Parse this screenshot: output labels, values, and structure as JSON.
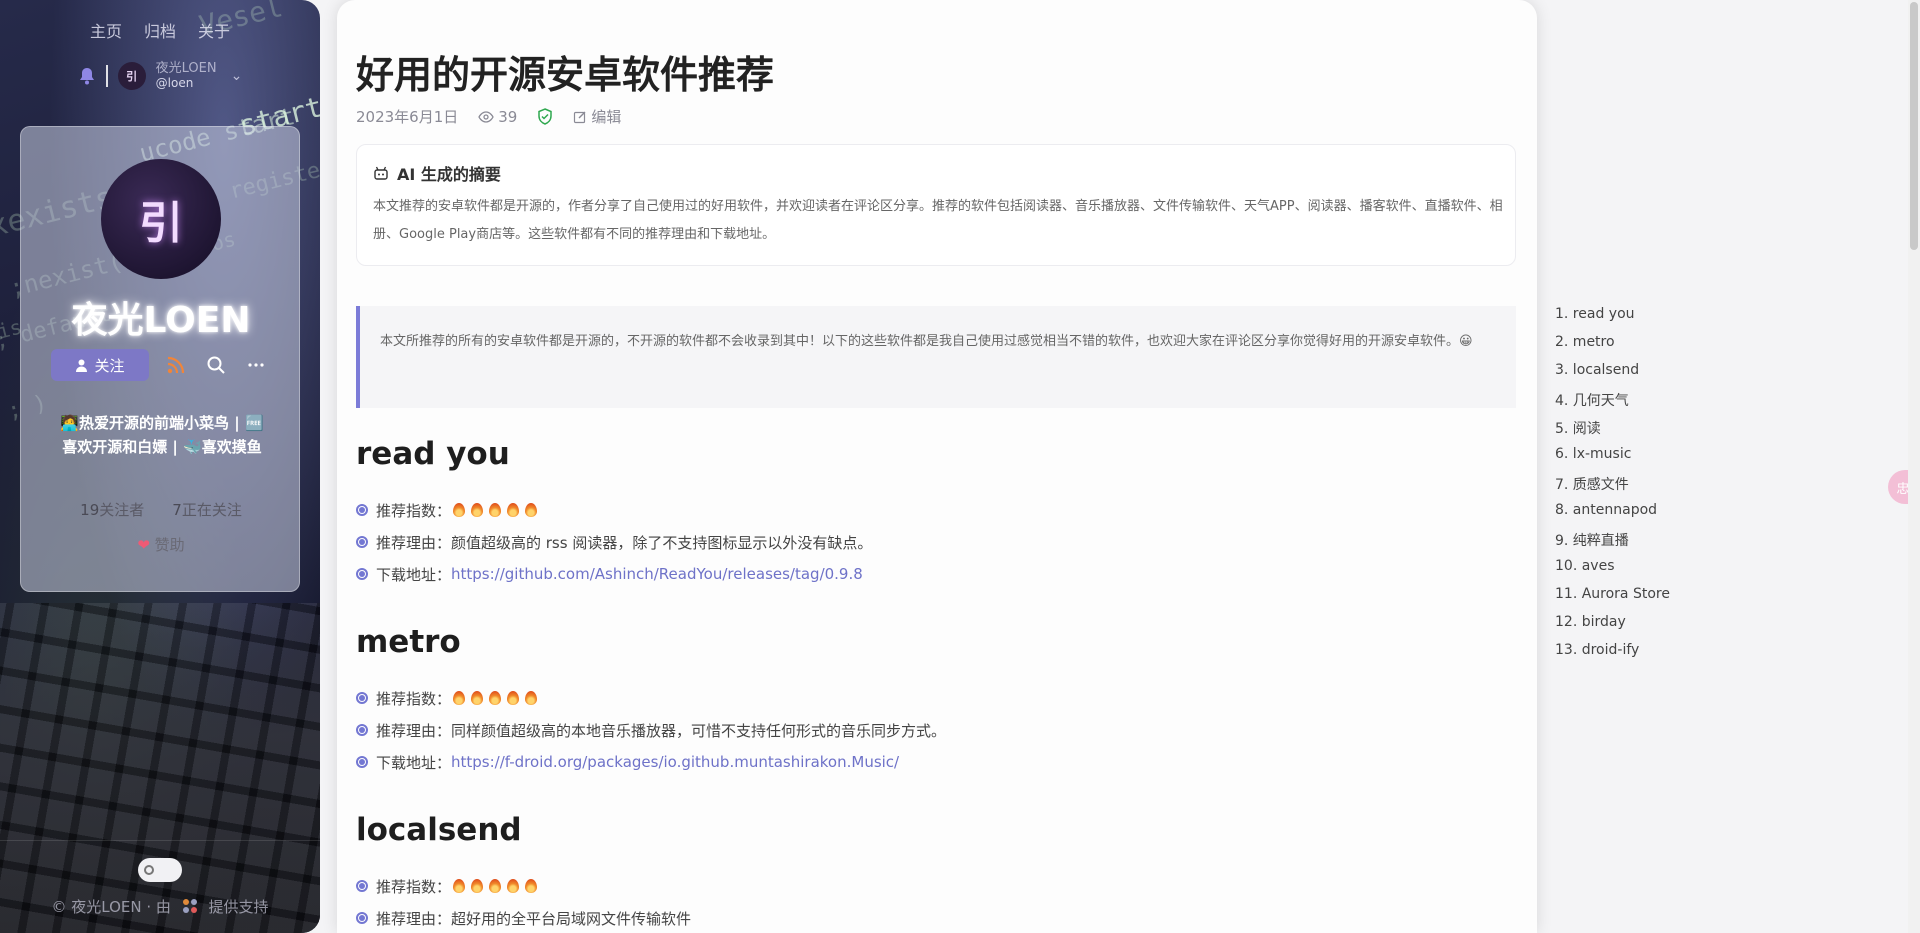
{
  "nav": {
    "items": [
      "主页",
      "归档",
      "关于"
    ]
  },
  "user": {
    "display_name": "夜光LOEN",
    "handle": "@loen",
    "avatar_glyph": "引"
  },
  "profile": {
    "avatar_glyph": "引",
    "name": "夜光LOEN",
    "follow_label": "关注",
    "bio": "🧑‍💻热爱开源的前端小菜鸟 | 🆓喜欢开源和白嫖 | 🐳喜欢摸鱼",
    "followers_count": "19",
    "followers_label": "关注者",
    "following_count": "7",
    "following_label": "正在关注",
    "sponsor_label": "赞助"
  },
  "footer": {
    "text": "© 夜光LOEN · 由",
    "support": "提供支持"
  },
  "article": {
    "title": "好用的开源安卓软件推荐",
    "date": "2023年6月1日",
    "views": "39",
    "edit_label": "编辑",
    "ai_title": "AI 生成的摘要",
    "ai_summary": "本文推荐的安卓软件都是开源的，作者分享了自己使用过的好用软件，并欢迎读者在评论区分享。推荐的软件包括阅读器、音乐播放器、文件传输软件、天气APP、阅读器、播客软件、直播软件、相册、Google Play商店等。这些软件都有不同的推荐理由和下载地址。",
    "intro": "本文所推荐的所有的安卓软件都是开源的，不开源的软件都不会收录到其中！以下的这些软件都是我自己使用过感觉相当不错的软件，也欢迎大家在评论区分享你觉得好用的开源安卓软件。😀",
    "sections": [
      {
        "heading": "read you",
        "rating_label": "推荐指数：",
        "reason": "推荐理由：颜值超级高的 rss 阅读器，除了不支持图标显示以外没有缺点。",
        "download_label": "下载地址：",
        "download_url": "https://github.com/Ashinch/ReadYou/releases/tag/0.9.8"
      },
      {
        "heading": "metro",
        "rating_label": "推荐指数：",
        "reason": "推荐理由：同样颜值超级高的本地音乐播放器，可惜不支持任何形式的音乐同步方式。",
        "download_label": "下载地址：",
        "download_url": "https://f-droid.org/packages/io.github.muntashirakon.Music/"
      },
      {
        "heading": "localsend",
        "rating_label": "推荐指数：",
        "reason": "推荐理由：超好用的全平台局域网文件传输软件"
      }
    ]
  },
  "toc": [
    "1. read you",
    "2. metro",
    "3. localsend",
    "4. 几何天气",
    "5. 阅读",
    "6. lx-music",
    "7. 质感文件",
    "8. antennapod",
    "9. 纯粹直播",
    "10. aves",
    "11. Aurora Store",
    "12. birday",
    "13. droid-ify"
  ],
  "side_bubble": {
    "text": "忠"
  },
  "colors": {
    "accent": "#7377d2",
    "link": "#6e72c8",
    "follow_button": "#7d78c6"
  },
  "code_bg": {
    "lines": [
      "xexists(",
      ";nexist(",
      "; default",
      "is",
      "; )",
      "start",
      "ucode start",
      "register",
      "pos",
      "Vesel"
    ]
  }
}
